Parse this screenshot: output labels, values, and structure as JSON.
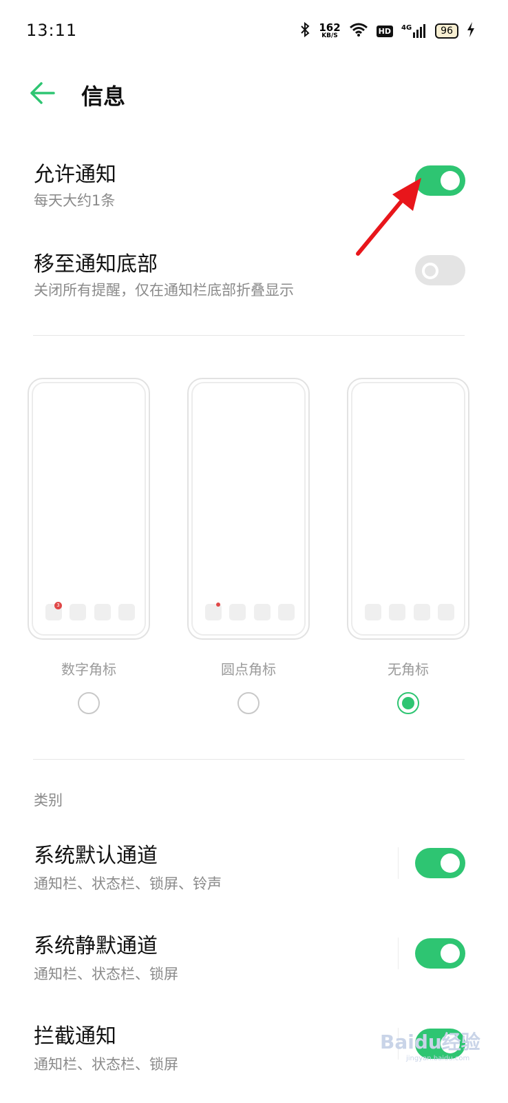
{
  "status_bar": {
    "time": "13:11",
    "net_speed_value": "162",
    "net_speed_unit": "KB/S",
    "hd_label": "HD",
    "signal_label": "4G",
    "battery_level": "96"
  },
  "header": {
    "title": "信息"
  },
  "settings": [
    {
      "title": "允许通知",
      "subtitle": "每天大约1条",
      "toggle": "on"
    },
    {
      "title": "移至通知底部",
      "subtitle": "关闭所有提醒，仅在通知栏底部折叠显示",
      "toggle": "off"
    }
  ],
  "badge_styles": {
    "options": [
      {
        "label": "数字角标",
        "selected": false,
        "badge_count": "3"
      },
      {
        "label": "圆点角标",
        "selected": false
      },
      {
        "label": "无角标",
        "selected": true
      }
    ]
  },
  "categories": {
    "label": "类别",
    "items": [
      {
        "title": "系统默认通道",
        "subtitle": "通知栏、状态栏、锁屏、铃声",
        "toggle": "on"
      },
      {
        "title": "系统静默通道",
        "subtitle": "通知栏、状态栏、锁屏",
        "toggle": "on"
      },
      {
        "title": "拦截通知",
        "subtitle": "通知栏、状态栏、锁屏",
        "toggle": "on"
      }
    ]
  },
  "watermark": {
    "text": "Baidu经验",
    "sub": "jingyan.baidu.com"
  },
  "colors": {
    "accent": "#2ec572",
    "annotation_arrow": "#e8161b",
    "badge": "#e04848"
  }
}
